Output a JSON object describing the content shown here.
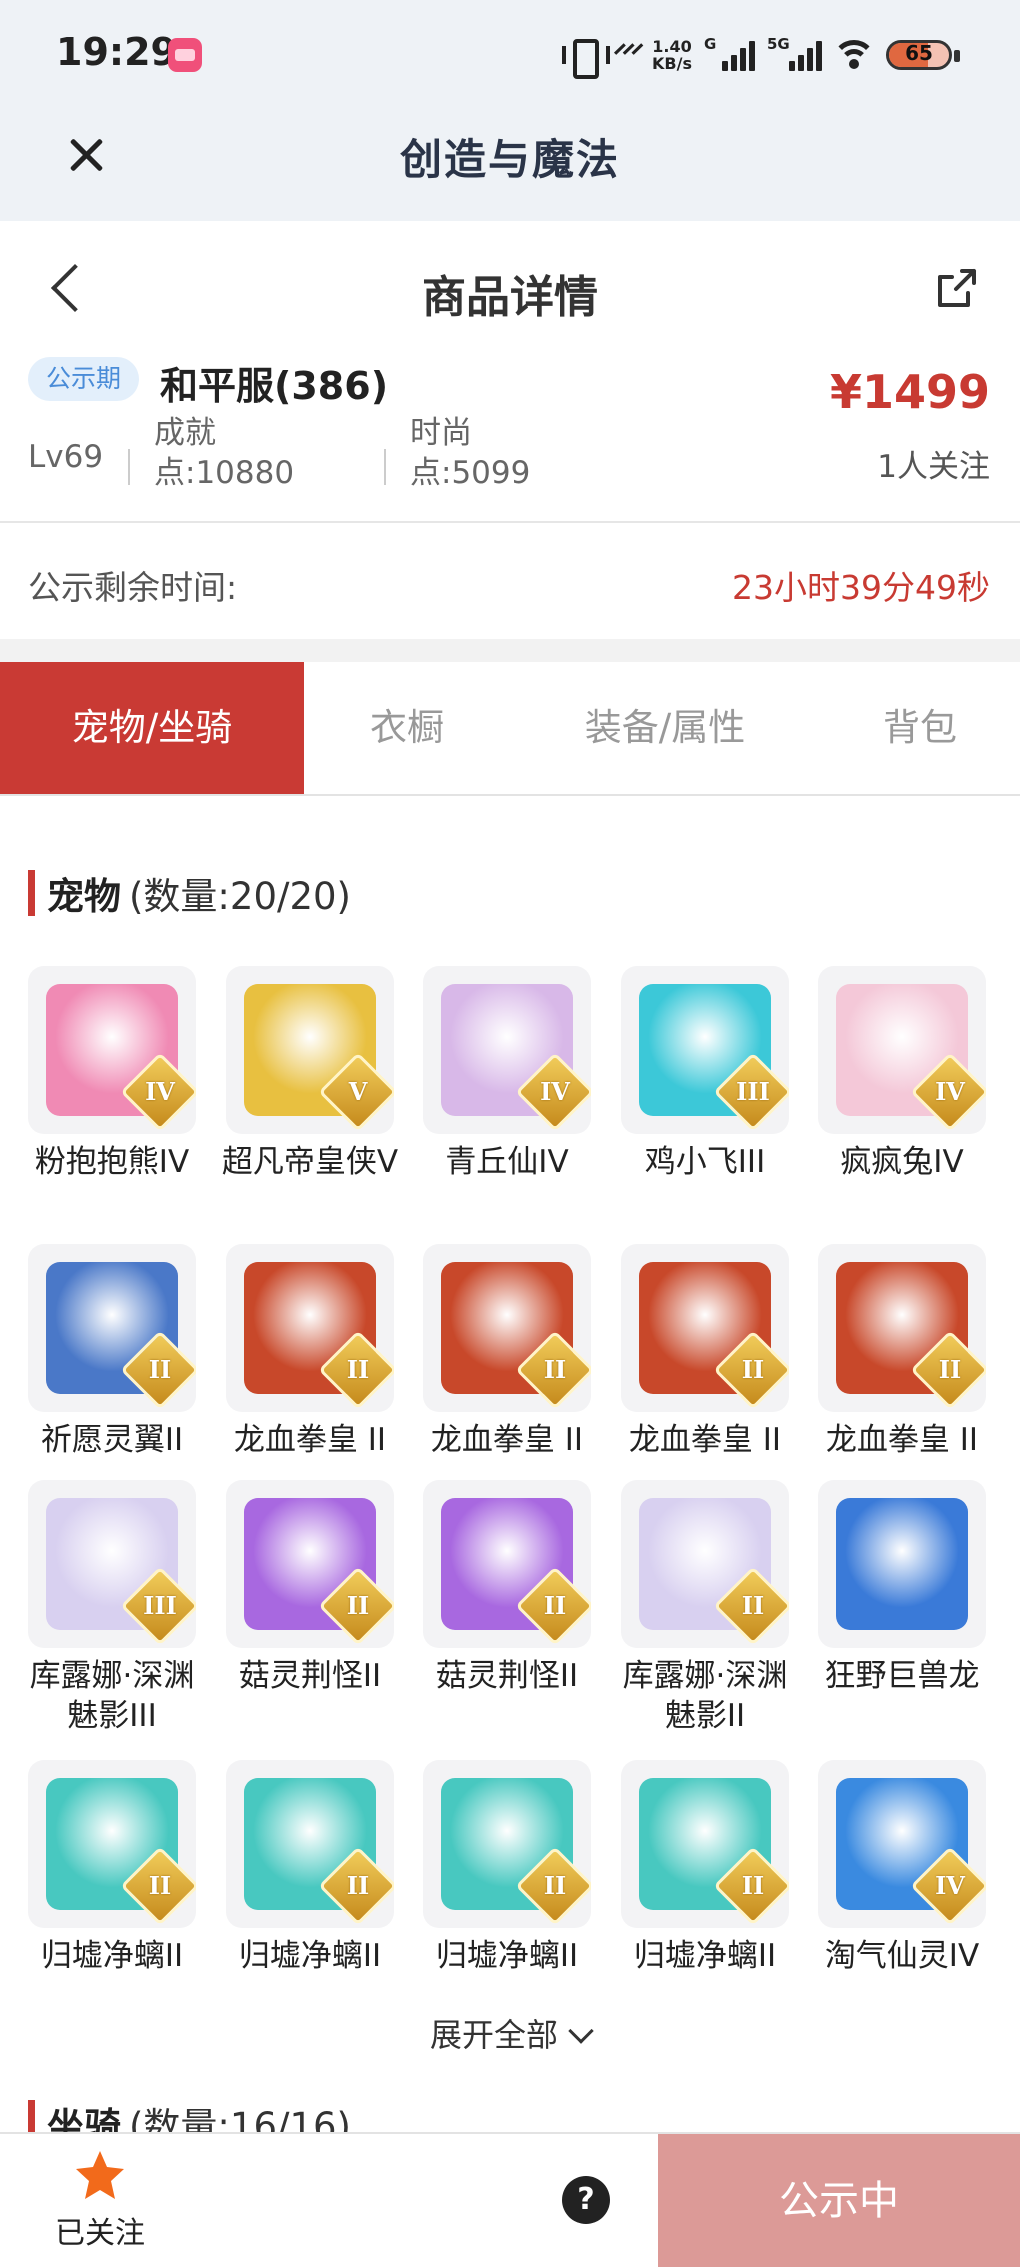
{
  "status_bar": {
    "time": "19:29",
    "speed_value": "1.40",
    "speed_unit": "KB/s",
    "net1_label": "G",
    "net2_label": "5G",
    "battery": "65",
    "battery_level": 0.65
  },
  "app": {
    "title": "创造与魔法"
  },
  "nav": {
    "title": "商品详情"
  },
  "product": {
    "badge": "公示期",
    "server": "和平服(386)",
    "price": "¥1499",
    "followers": "1人关注",
    "level": "Lv69",
    "achievement_line1": "成就",
    "achievement_line2": "点:10880",
    "fashion_line1": "时尚",
    "fashion_line2": "点:5099"
  },
  "countdown": {
    "label": "公示剩余时间:",
    "value": "23小时39分49秒"
  },
  "tabs": [
    "宠物/坐骑",
    "衣橱",
    "装备/属性",
    "背包"
  ],
  "pets_section": {
    "title": "宠物",
    "count": "(数量:20/20)"
  },
  "pets": [
    {
      "name": "粉抱抱熊IV",
      "grade": "IV",
      "color": "#f08ab4"
    },
    {
      "name": "超凡帝皇侠V",
      "grade": "V",
      "color": "#e8c040"
    },
    {
      "name": "青丘仙IV",
      "grade": "IV",
      "color": "#d8b8e8"
    },
    {
      "name": "鸡小飞III",
      "grade": "III",
      "color": "#3cc8d8"
    },
    {
      "name": "疯疯兔IV",
      "grade": "IV",
      "color": "#f4c8d8"
    },
    {
      "name": "祈愿灵翼II",
      "grade": "II",
      "color": "#4a78c8"
    },
    {
      "name": "龙血拳皇 II",
      "grade": "II",
      "color": "#c8482a"
    },
    {
      "name": "龙血拳皇 II",
      "grade": "II",
      "color": "#c8482a"
    },
    {
      "name": "龙血拳皇 II",
      "grade": "II",
      "color": "#c8482a"
    },
    {
      "name": "龙血拳皇 II",
      "grade": "II",
      "color": "#c8482a"
    },
    {
      "name": "库露娜·深渊魅影III",
      "grade": "III",
      "color": "#d8d0f0"
    },
    {
      "name": "菇灵荆怪II",
      "grade": "II",
      "color": "#a868e0"
    },
    {
      "name": "菇灵荆怪II",
      "grade": "II",
      "color": "#a868e0"
    },
    {
      "name": "库露娜·深渊魅影II",
      "grade": "II",
      "color": "#d8d0f0"
    },
    {
      "name": "狂野巨兽龙",
      "grade": "",
      "color": "#3a7ad8"
    },
    {
      "name": "归墟净螭II",
      "grade": "II",
      "color": "#48c8c0"
    },
    {
      "name": "归墟净螭II",
      "grade": "II",
      "color": "#48c8c0"
    },
    {
      "name": "归墟净螭II",
      "grade": "II",
      "color": "#48c8c0"
    },
    {
      "name": "归墟净螭II",
      "grade": "II",
      "color": "#48c8c0"
    },
    {
      "name": "淘气仙灵IV",
      "grade": "IV",
      "color": "#3a8ae0"
    }
  ],
  "expand_label": "展开全部",
  "mounts_section": {
    "title": "坐骑",
    "count": "(数量:16/16)"
  },
  "bottom": {
    "follow_label": "已关注",
    "help_label": "?",
    "status_label": "公示中"
  },
  "colors": {
    "accent": "#c93a34",
    "price": "#c83a32",
    "badge_bg": "#e3effb",
    "badge_text": "#4a8cd8",
    "status_button": "#dc9a97",
    "star": "#f26a1b"
  },
  "icons": [
    "vibrate-icon",
    "nfc-icon",
    "signal-icon",
    "wifi-icon",
    "battery-icon",
    "close-icon",
    "back-icon",
    "share-icon",
    "chevron-down-icon",
    "star-icon",
    "help-icon"
  ]
}
